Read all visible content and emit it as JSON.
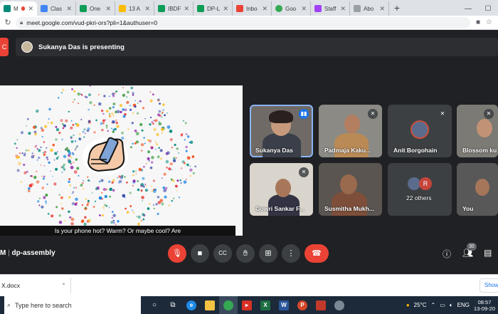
{
  "browser": {
    "tabs": [
      {
        "label": "M",
        "color": "#ea4335",
        "active": true
      },
      {
        "label": "Clas",
        "color": "#4285f4"
      },
      {
        "label": "One",
        "color": "#0f9d58"
      },
      {
        "label": "13 A",
        "color": "#fbbc04"
      },
      {
        "label": "IBDF",
        "color": "#0f9d58"
      },
      {
        "label": "DP-L",
        "color": "#0f9d58"
      },
      {
        "label": "Inbo",
        "color": "#ea4335"
      },
      {
        "label": "Goo",
        "color": "#34a853"
      },
      {
        "label": "Staff",
        "color": "#a142f4"
      },
      {
        "label": "Abo",
        "color": "#9aa0a6"
      }
    ],
    "new_tab": "+",
    "url": "meet.google.com/vud-pkri-ors?pli=1&authuser=0"
  },
  "meet": {
    "presenting_text": "Sukanya Das is presenting",
    "caption_text": "Is your phone hot? Warm? Or maybe cool? Are",
    "meeting_name": "dp-assembly",
    "meeting_prefix": "M",
    "participant_count": "30",
    "participants": [
      {
        "name": "Sukanya Das",
        "speaking": true
      },
      {
        "name": "Padmaja Kaku..."
      },
      {
        "name": "Anit Borgohain"
      },
      {
        "name": "Blossom ku"
      },
      {
        "name": "Gowri Sankar F..."
      },
      {
        "name": "Susmitha Mukh..."
      },
      {
        "name": "22 others",
        "initial": "R"
      },
      {
        "name": "You"
      }
    ]
  },
  "downloads": {
    "item": "X.docx",
    "show_all": "Show"
  },
  "taskbar": {
    "search_placeholder": "Type here to search",
    "weather": "25°C",
    "language": "ENG",
    "time": "08:57",
    "date": "13-09-20"
  },
  "colors": {
    "meet_bg": "#202124",
    "end_call": "#ea4335",
    "speaking_border": "#8ab4f8"
  }
}
